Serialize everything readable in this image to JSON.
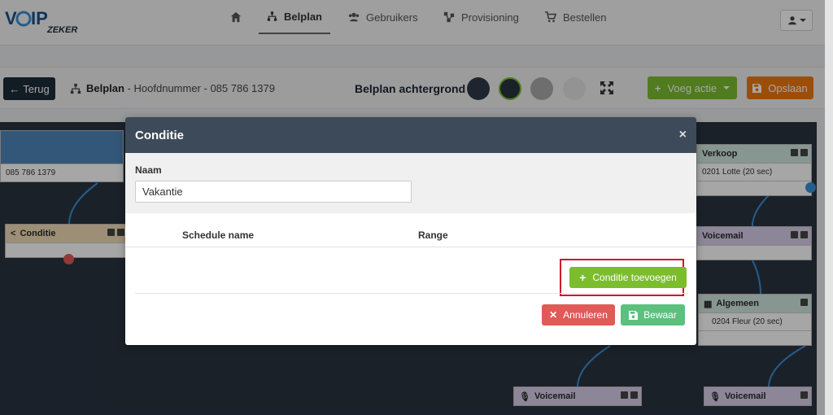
{
  "logo": {
    "main": "VOIP",
    "sub": "ZEKER"
  },
  "nav": {
    "items": [
      {
        "label": "",
        "icon": "home-icon"
      },
      {
        "label": "Belplan",
        "icon": "sitemap-icon",
        "active": true
      },
      {
        "label": "Gebruikers",
        "icon": "users-icon"
      },
      {
        "label": "Provisioning",
        "icon": "network-icon"
      },
      {
        "label": "Bestellen",
        "icon": "cart-icon"
      }
    ],
    "user_icon": "user-icon"
  },
  "toolbar": {
    "back_label": "Terug",
    "crumb_title": "Belplan",
    "crumb_detail": " - Hoofdnummer - 085 786 1379",
    "background_label": "Belplan achtergrond",
    "swatches": [
      "#2e3a48",
      "#2a3340",
      "#a9a9a9",
      "#e2e2e2"
    ],
    "add_action_label": "Voeg actie",
    "save_label": "Opslaan"
  },
  "canvas": {
    "nodes": {
      "start_number": "085 786 1379",
      "conditie_title": "Conditie",
      "verkoop_title": "Verkoop",
      "verkoop_row": "0201 Lotte (20 sec)",
      "voicemail_title": "Voicemail",
      "algemeen_title": "Algemeen",
      "algemeen_row": "0204 Fleur (20 sec)"
    }
  },
  "modal": {
    "title": "Conditie",
    "close": "×",
    "name_label": "Naam",
    "name_value": "Vakantie",
    "col_schedule": "Schedule name",
    "col_range": "Range",
    "add_condition_label": "Conditie toevoegen",
    "cancel_label": "Annuleren",
    "save_label": "Bewaar"
  },
  "colors": {
    "accent_green": "#7cbd2e",
    "save_orange": "#f0780f",
    "cancel_red": "#e05a57",
    "bewaar_green": "#5cc07e",
    "modal_header": "#3d4a5a",
    "highlight": "#d01528"
  }
}
